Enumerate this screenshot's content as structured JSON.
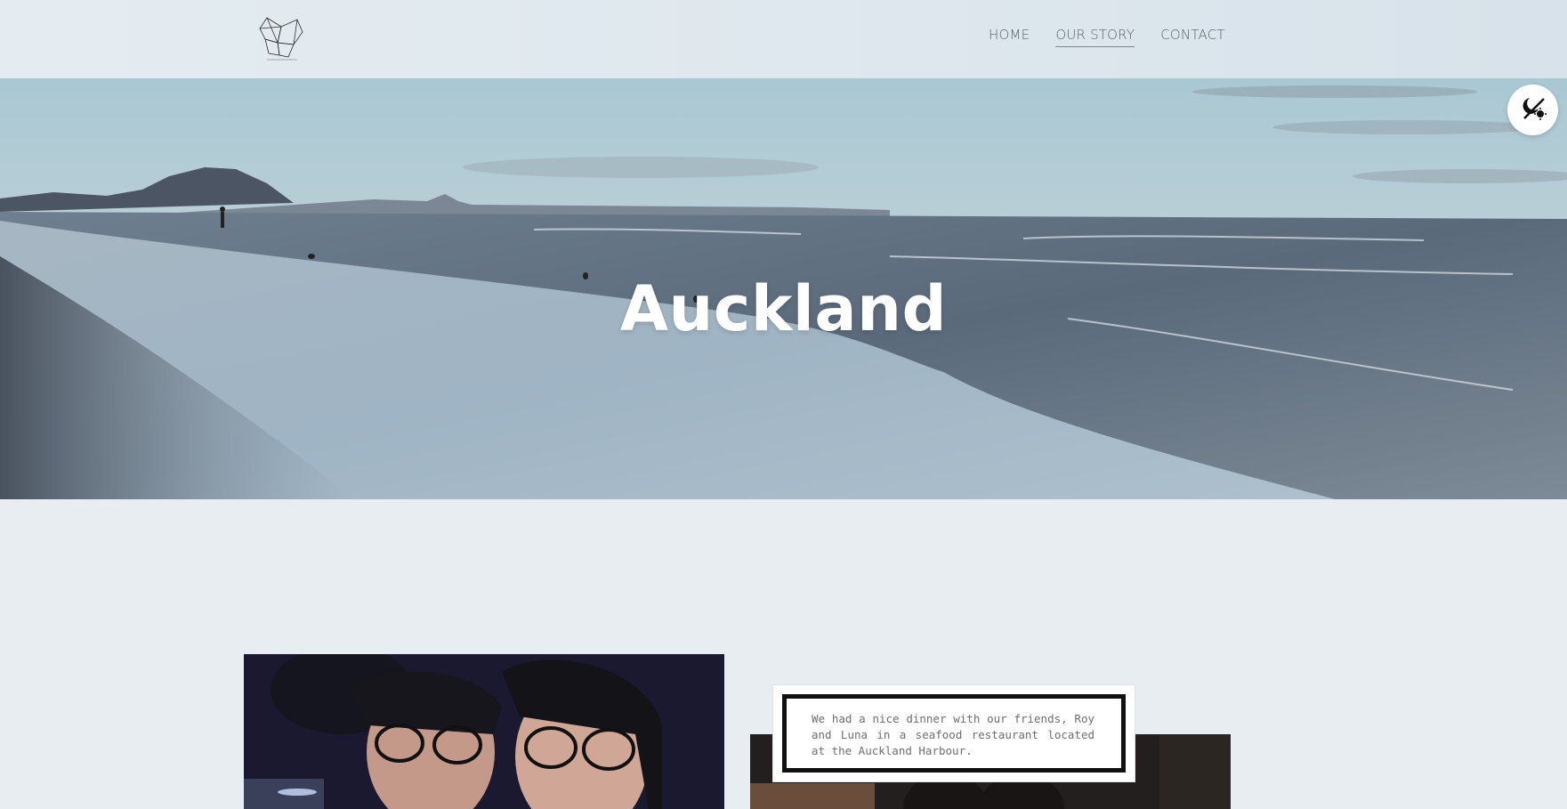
{
  "header": {
    "logo_icon": "geometric-flower-logo",
    "nav": [
      {
        "label": "HOME",
        "active": false
      },
      {
        "label": "OUR STORY",
        "active": true
      },
      {
        "label": "CONTACT",
        "active": false
      }
    ]
  },
  "hero": {
    "title": "Auckland",
    "background": "beach-at-dusk-photo"
  },
  "fab": {
    "icon": "theme-toggle-icon"
  },
  "content": {
    "left_photo": "selfie-photo-night",
    "right_photo": "restaurant-photo",
    "caption": "We had a nice dinner with our friends, Roy and Luna in a seafood restaurant located at the Auckland Harbour."
  },
  "colors": {
    "page_bg": "#e8edf2",
    "nav_text": "#56606a",
    "hero_text": "#ffffff"
  }
}
